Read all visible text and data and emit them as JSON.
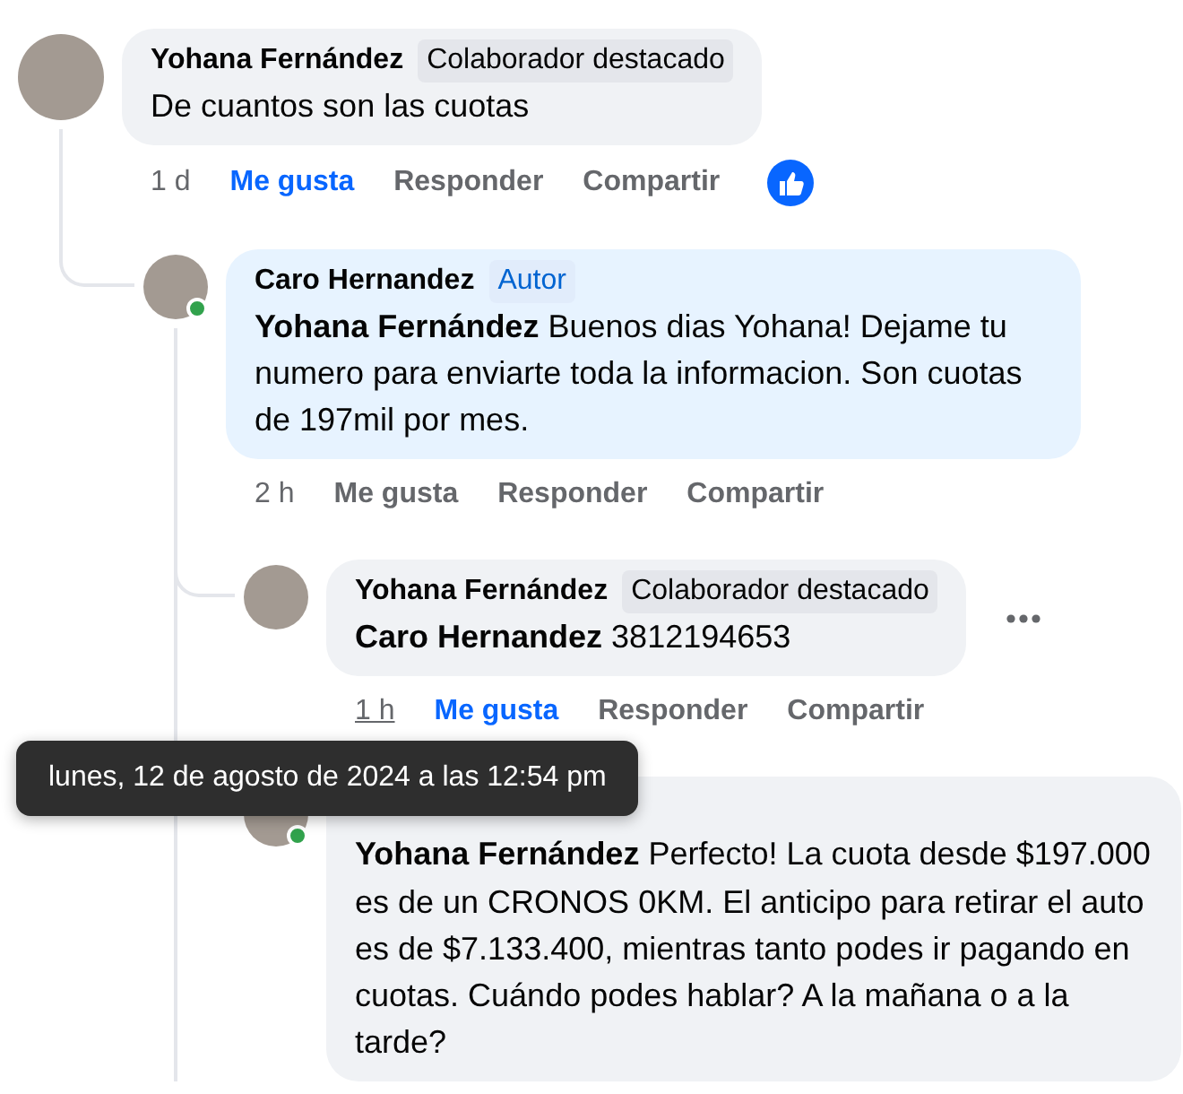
{
  "comments": [
    {
      "author": "Yohana Fernández",
      "badge": {
        "kind": "top_contributor",
        "label": "Colaborador destacado"
      },
      "text": "De cuantos son las cuotas",
      "time": "1 d",
      "liked": true,
      "like_reaction": true,
      "actions": {
        "like": "Me gusta",
        "reply": "Responder",
        "share": "Compartir"
      },
      "children": [
        {
          "author": "Caro Hernandez",
          "badge": {
            "kind": "author",
            "label": "Autor"
          },
          "online": true,
          "highlighted": true,
          "text": "**Yohana Fernández** Buenos dias Yohana! Dejame tu numero para enviarte toda la informacion. Son cuotas de 197mil por mes.",
          "time": "2 h",
          "liked": false,
          "more_replies_below": true,
          "actions": {
            "like": "Me gusta",
            "reply": "Responder",
            "share": "Compartir"
          },
          "children": [
            {
              "author": "Yohana Fernández",
              "badge": {
                "kind": "top_contributor",
                "label": "Colaborador destacado"
              },
              "text": "**Caro Hernandez** 3812194653",
              "time": "1 h",
              "tooltip": "lunes, 12 de agosto de 2024 a las 12:54 pm",
              "liked": true,
              "more_button": true,
              "actions": {
                "like": "Me gusta",
                "reply": "Responder",
                "share": "Compartir"
              }
            },
            {
              "online": true,
              "text": "**Yohana Fernández** Perfecto! La cuota desde $197.000 es de un CRONOS 0KM. El anticipo para retirar el auto es de $7.133.400, mientras tanto podes ir pagando en cuotas. Cuándo podes hablar? A la mañana o a la tarde?"
            }
          ]
        }
      ]
    }
  ]
}
